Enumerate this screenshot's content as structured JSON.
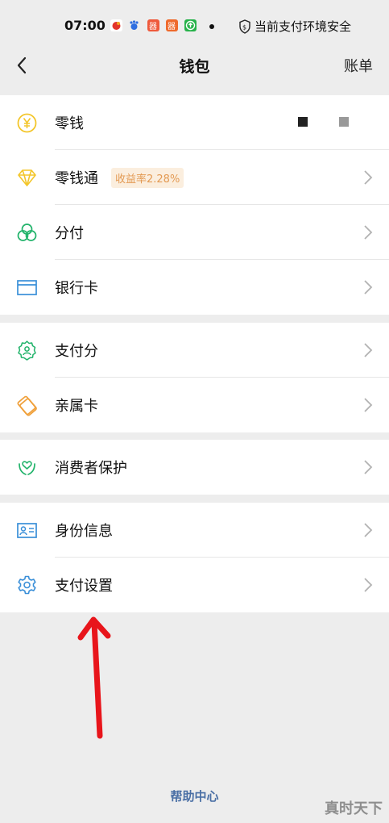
{
  "status": {
    "time": "07:00",
    "secure_text": "当前支付环境安全"
  },
  "nav": {
    "title": "钱包",
    "right": "账单"
  },
  "groups": [
    [
      {
        "label": "零钱",
        "icon": "yen-coin-icon"
      },
      {
        "label": "零钱通",
        "icon": "diamond-icon",
        "tag": "收益率2.28%"
      },
      {
        "label": "分付",
        "icon": "installment-icon"
      },
      {
        "label": "银行卡",
        "icon": "bank-card-icon"
      }
    ],
    [
      {
        "label": "支付分",
        "icon": "pay-score-icon"
      },
      {
        "label": "亲属卡",
        "icon": "family-card-icon"
      }
    ],
    [
      {
        "label": "消费者保护",
        "icon": "consumer-protection-icon"
      }
    ],
    [
      {
        "label": "身份信息",
        "icon": "id-card-icon"
      },
      {
        "label": "支付设置",
        "icon": "gear-icon"
      }
    ]
  ],
  "footer": {
    "help": "帮助中心",
    "watermark": "真时天下"
  },
  "colors": {
    "background": "#ededed",
    "tag_bg": "#fbeede",
    "tag_text": "#e39a53",
    "link": "#4a6fa5",
    "arrow": "#e8151b"
  }
}
